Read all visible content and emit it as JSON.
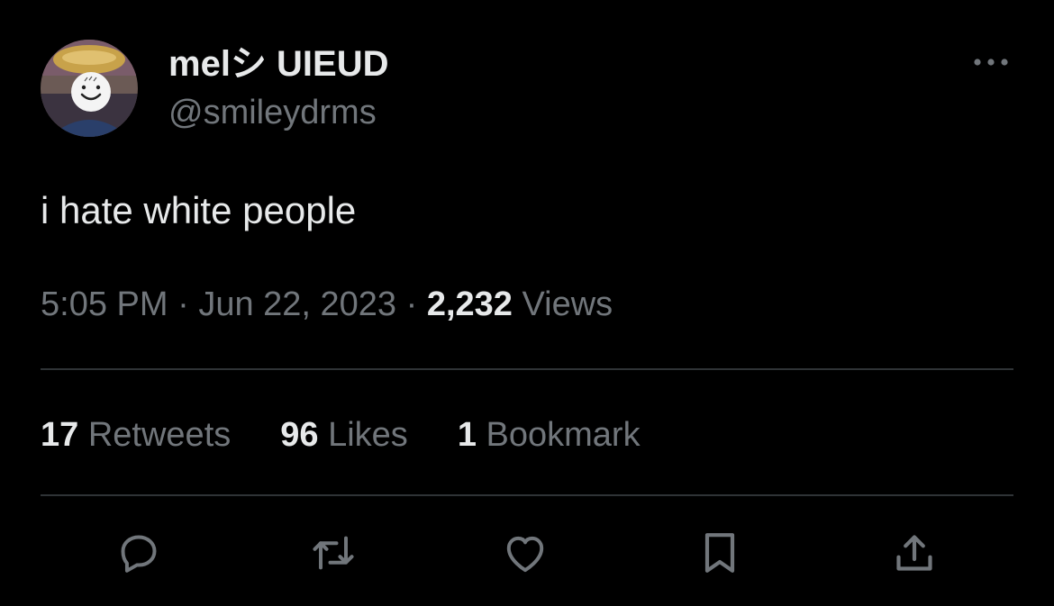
{
  "tweet": {
    "author": {
      "display_name": "melシ UIEUD",
      "handle": "@smileydrms"
    },
    "text": "i hate white people",
    "meta": {
      "time": "5:05 PM",
      "separator": "·",
      "date": "Jun 22, 2023",
      "views_count": "2,232",
      "views_label": "Views"
    },
    "stats": [
      {
        "count": "17",
        "label": "Retweets"
      },
      {
        "count": "96",
        "label": "Likes"
      },
      {
        "count": "1",
        "label": "Bookmark"
      }
    ],
    "actions": [
      {
        "icon": "reply-icon"
      },
      {
        "icon": "retweet-icon"
      },
      {
        "icon": "like-icon"
      },
      {
        "icon": "bookmark-icon"
      },
      {
        "icon": "share-icon"
      }
    ]
  },
  "colors": {
    "background": "#000000",
    "primary_text": "#e7e9ea",
    "secondary_text": "#71767b",
    "divider": "#2f3336"
  }
}
